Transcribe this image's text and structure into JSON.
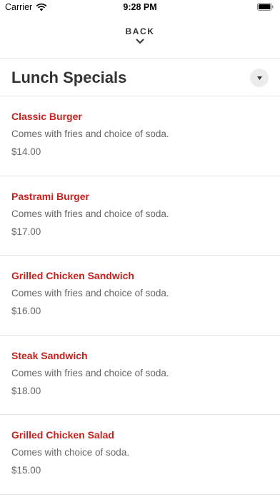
{
  "status_bar": {
    "carrier": "Carrier",
    "time": "9:28 PM",
    "icons": [
      "wifi-icon",
      "battery-icon"
    ]
  },
  "nav": {
    "back_label": "BACK",
    "back_icon": "chevron-down-icon"
  },
  "section": {
    "title": "Lunch Specials",
    "dropdown_icon": "caret-down-icon"
  },
  "colors": {
    "item_name": "#c9211e",
    "text_primary": "#333333",
    "text_secondary": "#666666",
    "divider": "#e6e6e6"
  },
  "items": [
    {
      "name": "Classic Burger",
      "description": "Comes with fries and choice of soda.",
      "price": "$14.00"
    },
    {
      "name": "Pastrami Burger",
      "description": "Comes with fries and choice of soda.",
      "price": "$17.00"
    },
    {
      "name": "Grilled Chicken Sandwich",
      "description": "Comes with fries and choice of soda.",
      "price": "$16.00"
    },
    {
      "name": "Steak Sandwich",
      "description": "Comes with fries and choice of soda.",
      "price": "$18.00"
    },
    {
      "name": "Grilled Chicken Salad",
      "description": "Comes with choice of soda.",
      "price": "$15.00"
    }
  ]
}
